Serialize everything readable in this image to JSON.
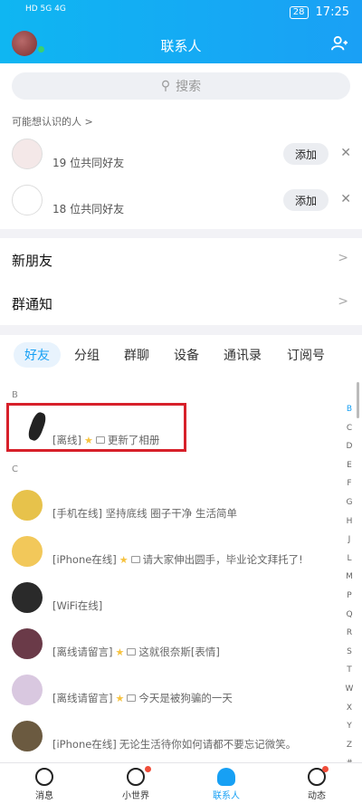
{
  "status": {
    "time": "17:25",
    "battery": "28",
    "left_icons": "HD 5G 4G"
  },
  "header": {
    "title": "联系人"
  },
  "search": {
    "placeholder": "搜索"
  },
  "suggestions": {
    "title": "可能想认识的人 >",
    "rows": [
      {
        "mutual": "19 位共同好友",
        "add_label": "添加"
      },
      {
        "mutual": "18 位共同好友",
        "add_label": "添加"
      }
    ]
  },
  "menu": [
    {
      "label": "新朋友"
    },
    {
      "label": "群通知"
    }
  ],
  "tabs": [
    "好友",
    "分组",
    "群聊",
    "设备",
    "通讯录",
    "订阅号"
  ],
  "groups": {
    "b": "B",
    "c": "C"
  },
  "friends": [
    {
      "status": "[离线]",
      "extra": "更新了相册"
    },
    {
      "status": "[手机在线] 坚持底线    圈子干净    生活简单",
      "extra": ""
    },
    {
      "status": "[iPhone在线]",
      "extra": "请大家伸出圆手，毕业论文拜托了!"
    },
    {
      "status": "[WiFi在线]",
      "extra": ""
    },
    {
      "status": "[离线请留言]",
      "extra": "这就很奈斯[表情]"
    },
    {
      "status": "[离线请留言]",
      "extra": "今天是被狗骗的一天"
    },
    {
      "status": "[iPhone在线]",
      "extra": "无论生活待你如何请都不要忘记微笑。"
    }
  ],
  "alphabet": [
    "B",
    "C",
    "D",
    "E",
    "F",
    "G",
    "H",
    "J",
    "L",
    "M",
    "P",
    "Q",
    "R",
    "S",
    "T",
    "W",
    "X",
    "Y",
    "Z",
    "#"
  ],
  "nav": [
    {
      "label": "消息"
    },
    {
      "label": "小世界"
    },
    {
      "label": "联系人"
    },
    {
      "label": "动态"
    }
  ]
}
